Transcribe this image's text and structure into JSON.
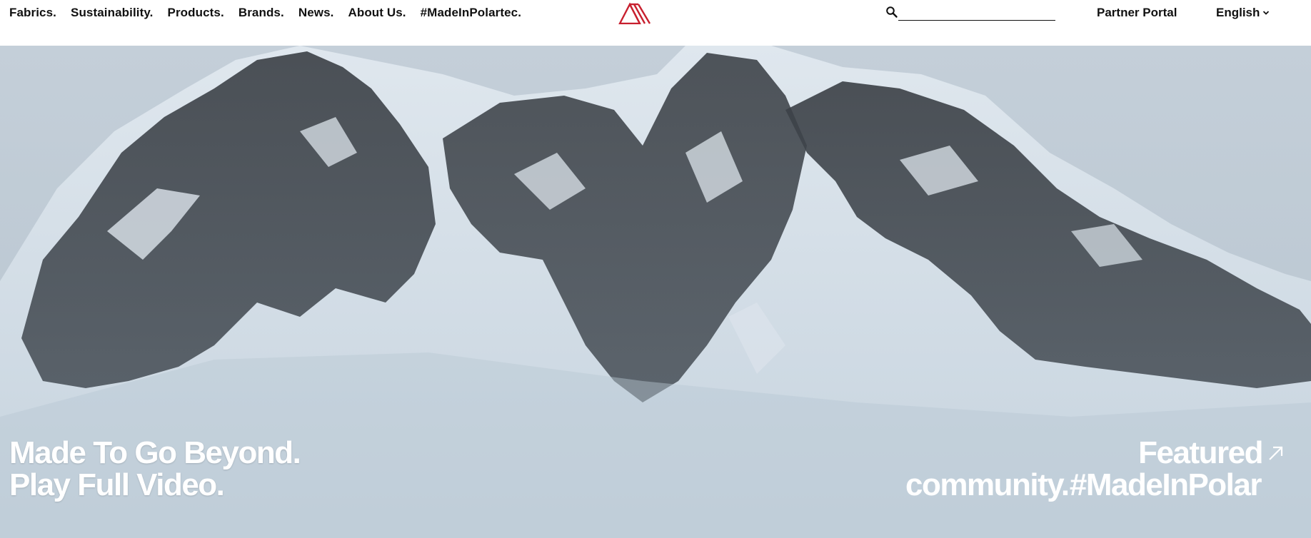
{
  "nav": {
    "items": [
      {
        "label": "Fabrics."
      },
      {
        "label": "Sustainability."
      },
      {
        "label": "Products."
      },
      {
        "label": "Brands."
      },
      {
        "label": "News."
      },
      {
        "label": "About Us."
      },
      {
        "label": "#MadeInPolartec."
      }
    ]
  },
  "logo": {
    "icon": "polartec-triangle-logo",
    "color": "#c8202f"
  },
  "search": {
    "icon": "search-icon",
    "value": "",
    "placeholder": ""
  },
  "header_right": {
    "partner_label": "Partner Portal",
    "language": "English"
  },
  "hero": {
    "line1": "Made To Go Beyond.",
    "line2": "Play Full Video.",
    "featured_label": "Featured",
    "featured_tag": "#MadeInPolar",
    "community_label": "community."
  }
}
